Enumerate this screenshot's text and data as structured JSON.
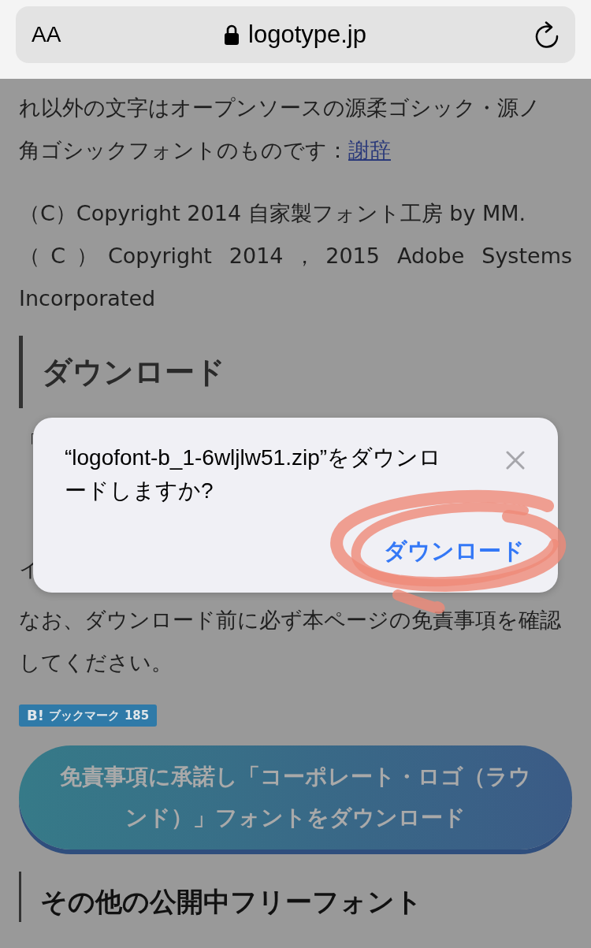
{
  "browser_bar": {
    "text_size_button": "AA",
    "url": "logotype.jp"
  },
  "credits": {
    "text": "れ以外の文字はオープンソースの源柔ゴシック・源ノ角ゴシックフォントのものです：",
    "link": "謝辞"
  },
  "copyrights": [
    {
      "text": "（C）Copyright 2014 自家製フォント工房 by MM."
    },
    {
      "text": "（C）Copyright 2014，2015 Adobe Systems Incorporated"
    }
  ],
  "heading": "ダウンロード",
  "obscured_fragments": [
    {
      "text": "「"
    },
    {
      "text": "イ"
    }
  ],
  "dialog": {
    "message": "“logofont-b_1-6wljlw51.zip”をダウンロードしますか?",
    "button": "ダウンロード"
  },
  "notice": "なお、ダウンロード前に必ず本ページの免責事項を確認してください。",
  "bookmark_badge": {
    "logo": "B!",
    "label": "ブックマーク",
    "count": "185"
  },
  "download_button": "免責事項に承諾し「コーポレート・ロゴ（ラウンド）」フォントをダウンロード",
  "section_heading": "その他の公開中フリーフォント"
}
